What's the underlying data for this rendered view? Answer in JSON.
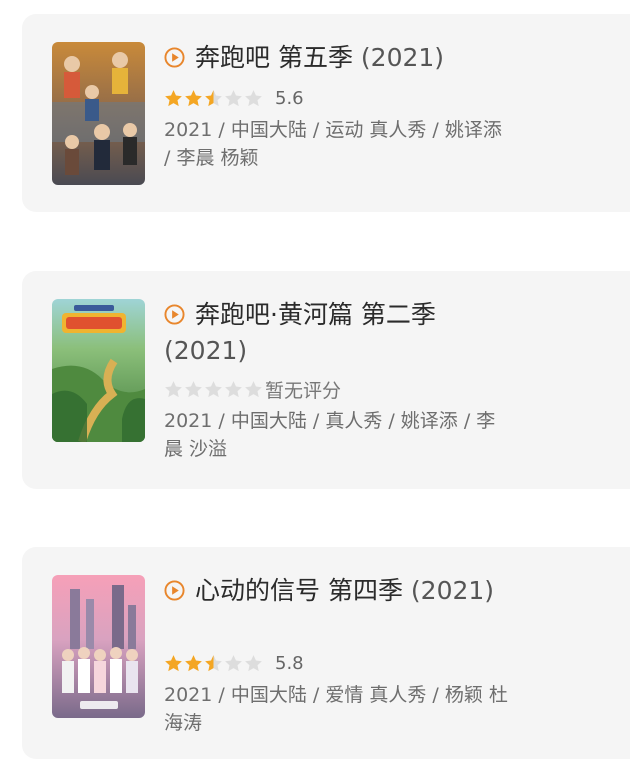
{
  "colors": {
    "card_background": "#f5f5f5",
    "accent_orange": "#e8862c",
    "star_filled": "#f4a623",
    "star_empty": "#dddddd"
  },
  "items": [
    {
      "title": "奔跑吧 第五季",
      "year": "(2021)",
      "rating_stars": 2.5,
      "score": "5.6",
      "meta": "2021 / 中国大陆 / 运动 真人秀 / 姚译添 / 李晨 杨颖",
      "icon": "play-circle-icon"
    },
    {
      "title": "奔跑吧·黄河篇 第二季",
      "year": "(2021)",
      "rating_stars": 0,
      "no_score_label": "暂无评分",
      "meta": "2021 / 中国大陆 / 真人秀 / 姚译添 / 李晨 沙溢",
      "icon": "play-circle-icon"
    },
    {
      "title": "心动的信号 第四季",
      "year": "(2021)",
      "rating_stars": 2.5,
      "score": "5.8",
      "meta": "2021 / 中国大陆 / 爱情 真人秀 / 杨颖 杜海涛",
      "icon": "play-circle-icon"
    }
  ]
}
